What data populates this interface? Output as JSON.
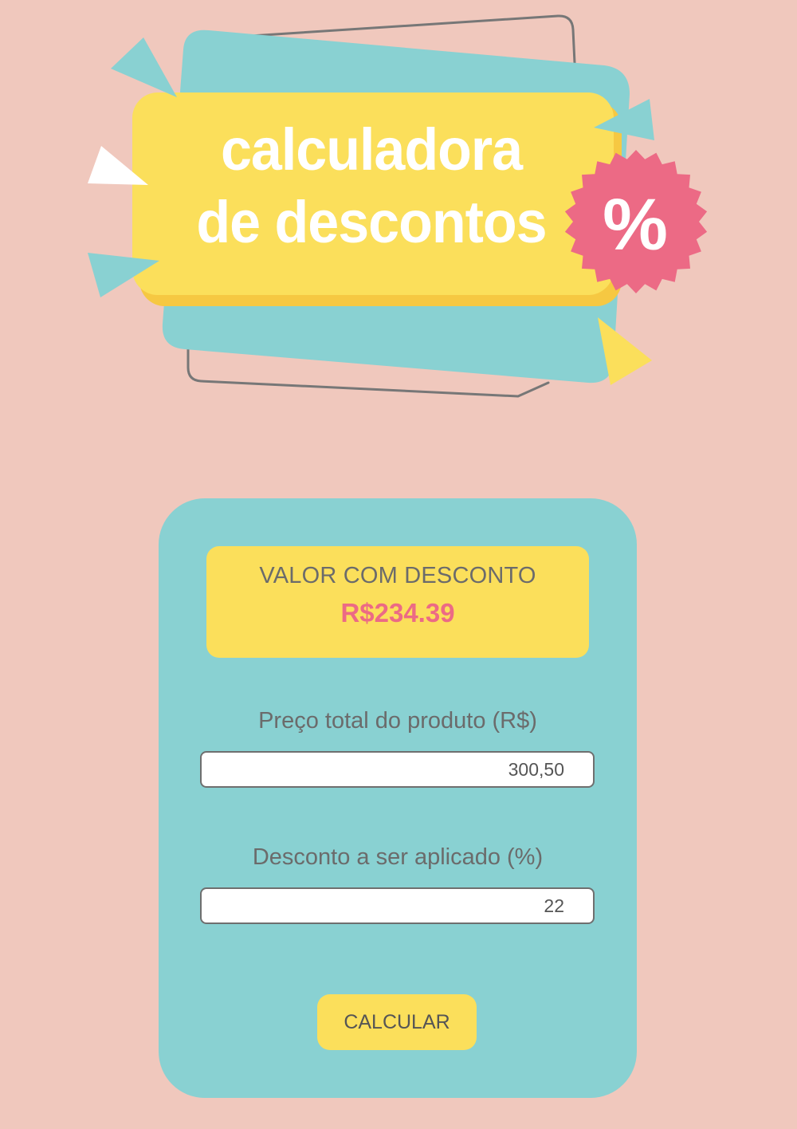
{
  "header": {
    "title_line1": "calculadora",
    "title_line2": "de descontos",
    "badge_symbol": "%"
  },
  "result": {
    "label": "VALOR COM DESCONTO",
    "value": "R$234.39"
  },
  "form": {
    "price": {
      "label": "Preço total do produto (R$)",
      "value": "300,50"
    },
    "discount": {
      "label": "Desconto a ser aplicado (%)",
      "value": "22"
    },
    "submit_label": "CALCULAR"
  },
  "colors": {
    "background": "#f0c8bd",
    "teal": "#89d1d2",
    "yellow": "#fbdf5b",
    "pink": "#ec6a85",
    "text_gray": "#6b6b6b"
  }
}
